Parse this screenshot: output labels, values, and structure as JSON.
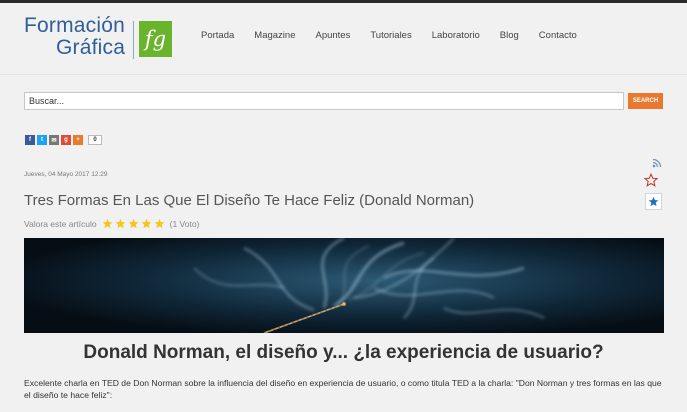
{
  "header": {
    "logo_line1": "Formación",
    "logo_line2": "Gráfica",
    "logo_mark": "fg",
    "nav": [
      "Portada",
      "Magazine",
      "Apuntes",
      "Tutoriales",
      "Laboratorio",
      "Blog",
      "Contacto"
    ]
  },
  "search": {
    "placeholder": "Buscar...",
    "button_label": "SEARCH"
  },
  "share": {
    "icons": [
      "facebook-icon",
      "twitter-icon",
      "email-icon",
      "googleplus-icon",
      "add-icon"
    ],
    "count": "0"
  },
  "article": {
    "date": "Jueves, 04 Mayo 2017 12:29",
    "title": "Tres Formas En Las Que El Diseño Te Hace Feliz (Donald Norman)",
    "rating_label": "Valora este artículo",
    "rating_value": 5,
    "votes": "(1 Voto)",
    "headline": "Donald Norman, el diseño y... ¿la experiencia de usuario?",
    "intro": "Excelente charla en TED de Don Norman sobre la influencia del diseño en experiencia de usuario, o como titula TED a la charla: \"Don Norman y tres formas en las que el diseño te hace feliz\":"
  },
  "colors": {
    "brand_blue": "#2f5f9a",
    "brand_green": "#6ab42d",
    "accent_orange": "#e8792e",
    "star_gold": "#f5c518"
  }
}
